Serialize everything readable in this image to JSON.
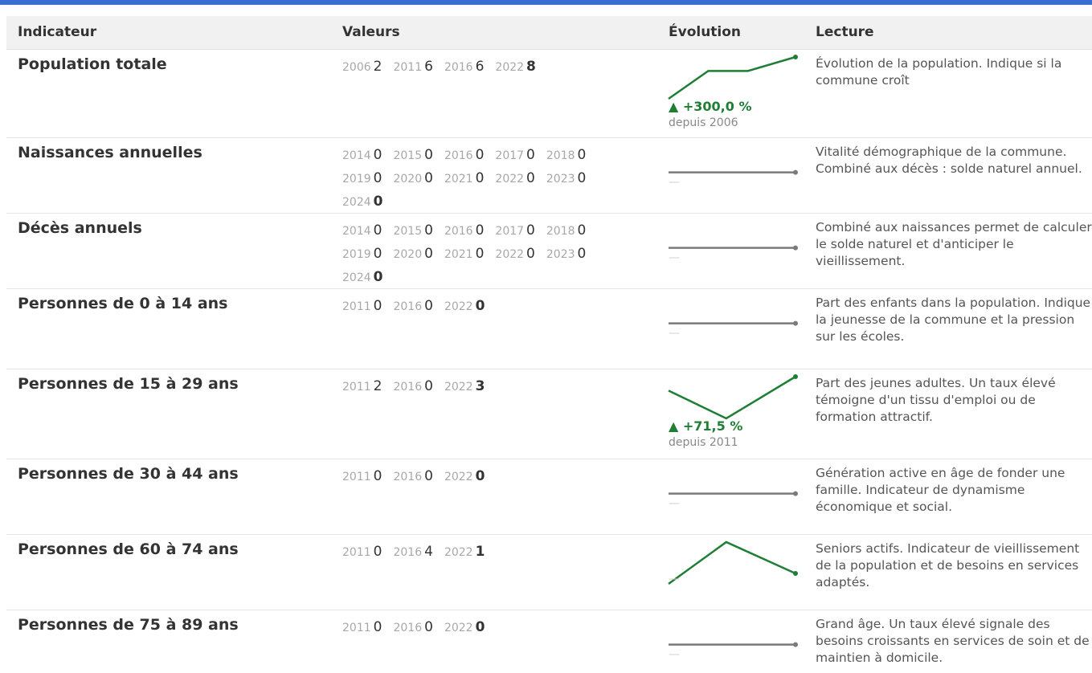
{
  "colors": {
    "accent": "#3a6fd1",
    "positive": "#1e7e34",
    "neutral": "#7a7a7a"
  },
  "header": {
    "indicator": "Indicateur",
    "values": "Valeurs",
    "evolution": "Évolution",
    "reading": "Lecture"
  },
  "rows": [
    {
      "name": "Population totale",
      "values": [
        {
          "year": "2006",
          "value": "2"
        },
        {
          "year": "2011",
          "value": "6"
        },
        {
          "year": "2016",
          "value": "6"
        },
        {
          "year": "2022",
          "value": "8"
        }
      ],
      "trend": "up",
      "delta": "▲ +300,0 %",
      "since": "depuis 2006",
      "reading": "Évolution de la population. Indique si la commune croît"
    },
    {
      "name": "Naissances annuelles",
      "values": [
        {
          "year": "2014",
          "value": "0"
        },
        {
          "year": "2015",
          "value": "0"
        },
        {
          "year": "2016",
          "value": "0"
        },
        {
          "year": "2017",
          "value": "0"
        },
        {
          "year": "2018",
          "value": "0"
        },
        {
          "year": "2019",
          "value": "0"
        },
        {
          "year": "2020",
          "value": "0"
        },
        {
          "year": "2021",
          "value": "0"
        },
        {
          "year": "2022",
          "value": "0"
        },
        {
          "year": "2023",
          "value": "0"
        },
        {
          "year": "2024",
          "value": "0"
        }
      ],
      "trend": "flat",
      "no_change": "—",
      "reading": "Vitalité démographique de la commune. Combiné aux décès : solde naturel annuel."
    },
    {
      "name": "Décès annuels",
      "values": [
        {
          "year": "2014",
          "value": "0"
        },
        {
          "year": "2015",
          "value": "0"
        },
        {
          "year": "2016",
          "value": "0"
        },
        {
          "year": "2017",
          "value": "0"
        },
        {
          "year": "2018",
          "value": "0"
        },
        {
          "year": "2019",
          "value": "0"
        },
        {
          "year": "2020",
          "value": "0"
        },
        {
          "year": "2021",
          "value": "0"
        },
        {
          "year": "2022",
          "value": "0"
        },
        {
          "year": "2023",
          "value": "0"
        },
        {
          "year": "2024",
          "value": "0"
        }
      ],
      "trend": "flat",
      "no_change": "—",
      "reading": "Combiné aux naissances permet de calculer le solde naturel et d'anticiper le vieillissement."
    },
    {
      "name": "Personnes de 0 à 14 ans",
      "values": [
        {
          "year": "2011",
          "value": "0"
        },
        {
          "year": "2016",
          "value": "0"
        },
        {
          "year": "2022",
          "value": "0"
        }
      ],
      "trend": "flat",
      "no_change": "—",
      "reading": "Part des enfants dans la population. Indique la jeunesse de la commune et la pression sur les écoles."
    },
    {
      "name": "Personnes de 15 à 29 ans",
      "values": [
        {
          "year": "2011",
          "value": "2"
        },
        {
          "year": "2016",
          "value": "0"
        },
        {
          "year": "2022",
          "value": "3"
        }
      ],
      "trend": "up",
      "delta": "▲ +71,5 %",
      "since": "depuis 2011",
      "reading": "Part des jeunes adultes. Un taux élevé témoigne d'un tissu d'emploi ou de formation attractif."
    },
    {
      "name": "Personnes de 30 à 44 ans",
      "values": [
        {
          "year": "2011",
          "value": "0"
        },
        {
          "year": "2016",
          "value": "0"
        },
        {
          "year": "2022",
          "value": "0"
        }
      ],
      "trend": "flat",
      "no_change": "—",
      "reading": "Génération active en âge de fonder une famille. Indicateur de dynamisme économique et social."
    },
    {
      "name": "Personnes de 60 à 74 ans",
      "values": [
        {
          "year": "2011",
          "value": "0"
        },
        {
          "year": "2016",
          "value": "4"
        },
        {
          "year": "2022",
          "value": "1"
        }
      ],
      "trend": "up",
      "no_change": "—",
      "reading": "Seniors actifs. Indicateur de vieillissement de la population et de besoins en services adaptés."
    },
    {
      "name": "Personnes de 75 à 89 ans",
      "values": [
        {
          "year": "2011",
          "value": "0"
        },
        {
          "year": "2016",
          "value": "0"
        },
        {
          "year": "2022",
          "value": "0"
        }
      ],
      "trend": "flat",
      "no_change": "—",
      "reading": "Grand âge. Un taux élevé signale des besoins croissants en services de soin et de maintien à domicile."
    }
  ]
}
